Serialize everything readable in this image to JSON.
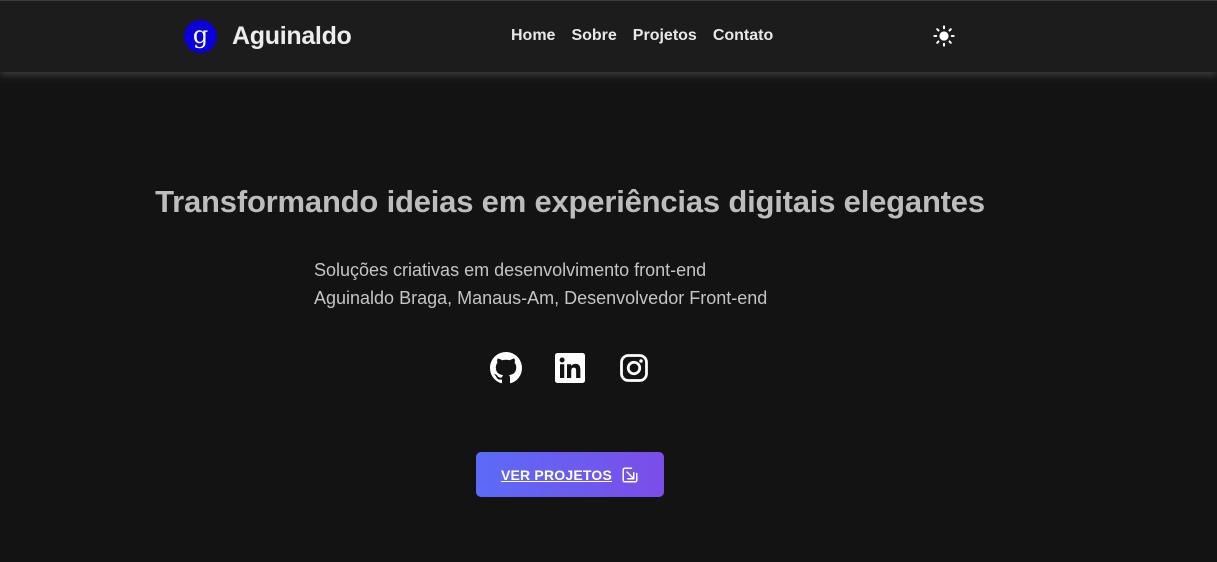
{
  "header": {
    "logo_letter": "g",
    "brand_name": "Aguinaldo",
    "nav": [
      {
        "label": "Home"
      },
      {
        "label": "Sobre"
      },
      {
        "label": "Projetos"
      },
      {
        "label": "Contato"
      }
    ],
    "theme_toggle_icon": "sun-icon"
  },
  "hero": {
    "title": "Transformando ideias em experiências digitais elegantes",
    "subtitle_line1": "Soluções criativas em desenvolvimento front-end",
    "subtitle_line2": "Aguinaldo Braga, Manaus-Am, Desenvolvedor Front-end",
    "socials": [
      {
        "icon": "github-icon"
      },
      {
        "icon": "linkedin-icon"
      },
      {
        "icon": "instagram-icon"
      }
    ],
    "cta_label": "VER PROJETOS",
    "cta_icon": "arrow-down-right-icon"
  },
  "colors": {
    "background": "#141314",
    "navbar": "#1d1c1d",
    "logo_blue": "#0a00d8",
    "cta_gradient_start": "#5b6bf7",
    "cta_gradient_end": "#7b4de8"
  }
}
